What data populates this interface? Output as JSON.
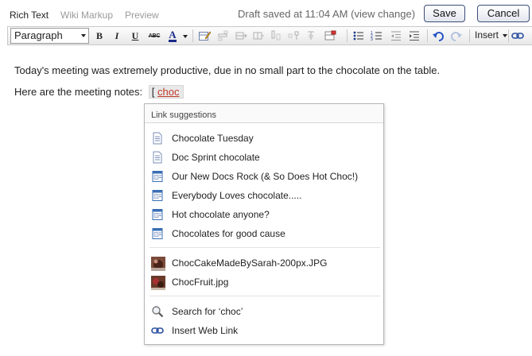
{
  "modes": {
    "rich_text": "Rich Text",
    "wiki_markup": "Wiki Markup",
    "preview": "Preview"
  },
  "draft": {
    "saved": "Draft saved at 11:04 AM",
    "view_change": "(view change)"
  },
  "buttons": {
    "save": "Save",
    "cancel": "Cancel"
  },
  "toolbar": {
    "paragraph": "Paragraph",
    "bold": "B",
    "italic": "I",
    "underline": "U",
    "strike": "ABC",
    "text_color": "A",
    "insert": "Insert",
    "icons": [
      "bold-icon",
      "italic-icon",
      "underline-icon",
      "strikethrough-icon",
      "text-color-icon",
      "edit-table-icon",
      "table-row-icon",
      "table-icon",
      "table-column-icon",
      "merge-cells-icon",
      "split-cells-icon",
      "delete-table-icon",
      "bullet-list-icon",
      "numbered-list-icon",
      "outdent-icon",
      "indent-icon",
      "undo-icon",
      "redo-icon",
      "link-icon"
    ]
  },
  "editor": {
    "line1": "Today's meeting was extremely productive, due in no small part to the chocolate on the table.",
    "line2_prefix": "Here are the meeting notes:",
    "token_bracket": "[",
    "token_query": "choc"
  },
  "suggestions": {
    "header": "Link suggestions",
    "pages": [
      {
        "label": "Chocolate Tuesday",
        "icon": "page-icon"
      },
      {
        "label": "Doc Sprint chocolate",
        "icon": "page-icon"
      },
      {
        "label": "Our New Docs Rock (& So Does Hot Choc!)",
        "icon": "blog-post-icon"
      },
      {
        "label": "Everybody Loves chocolate.....",
        "icon": "blog-post-icon"
      },
      {
        "label": "Hot chocolate anyone?",
        "icon": "blog-post-icon"
      },
      {
        "label": "Chocolates for good cause",
        "icon": "blog-post-icon"
      }
    ],
    "attachments": [
      {
        "label": "ChocCakeMadeBySarah-200px.JPG",
        "icon": "image-thumbnail-icon"
      },
      {
        "label": "ChocFruit.jpg",
        "icon": "image-thumbnail-icon"
      }
    ],
    "actions": [
      {
        "label": "Search for ‘choc’",
        "icon": "magnifier-icon"
      },
      {
        "label": "Insert Web Link",
        "icon": "link-icon"
      }
    ]
  },
  "colors": {
    "button_border": "#3c4d78",
    "query_underline": "#c0392b",
    "blog_icon": "#3a6fb5"
  }
}
